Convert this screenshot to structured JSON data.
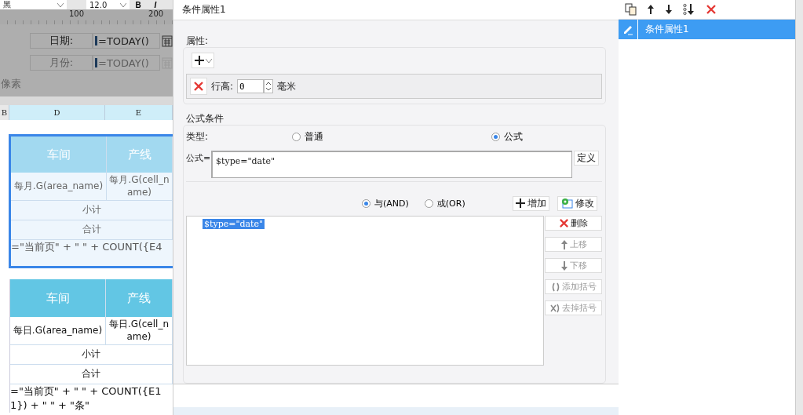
{
  "toolbar": {
    "font": "黑",
    "size": "12.0",
    "bold": "B",
    "italic": "I"
  },
  "ruler": {
    "ticks": [
      "100",
      "200"
    ]
  },
  "parameters": [
    {
      "label": "日期:",
      "value": "=TODAY()",
      "disabled": false
    },
    {
      "label": "月份:",
      "value": "=TODAY()",
      "disabled": true
    }
  ],
  "parameter_note": "像素",
  "column_headers": [
    "B",
    "D",
    "E"
  ],
  "report_tables": [
    {
      "selected": true,
      "headers": [
        "车间",
        "产线"
      ],
      "cells": [
        "每月.G(area_name)",
        "每月.G(cell_name)"
      ],
      "subtotal": "小计",
      "total": "合计",
      "footer": [
        "=\"当前页\" + \" \" + COUNT({E4"
      ]
    },
    {
      "selected": false,
      "headers": [
        "车间",
        "产线"
      ],
      "cells": [
        "每日.G(area_name)",
        "每日.G(cell_name)"
      ],
      "subtotal": "小计",
      "total": "合计",
      "footer": [
        "=\"当前页\" + \" \" + COUNT({E1",
        "1}) + \" \" + \"条\""
      ]
    }
  ],
  "dialog": {
    "title": "条件属性1",
    "properties": {
      "legend": "属性:",
      "rows": [
        {
          "label": "行高:",
          "value": "0",
          "unit": "毫米"
        }
      ]
    },
    "formula_condition": {
      "legend": "公式条件",
      "type_label": "类型:",
      "types": [
        {
          "label": "普通",
          "selected": false
        },
        {
          "label": "公式",
          "selected": true
        }
      ],
      "formula_label": "公式=",
      "formula": "$type=\"date\"",
      "define_button": "定义",
      "logic": [
        {
          "label": "与(AND)",
          "selected": true
        },
        {
          "label": "或(OR)",
          "selected": false
        }
      ],
      "add_button": "增加",
      "modify_button": "修改",
      "conditions": [
        {
          "text": "$type=\"date\"",
          "selected": true
        }
      ],
      "actions": [
        {
          "kind": "delete",
          "label": "删除",
          "disabled": false
        },
        {
          "kind": "up",
          "label": "上移",
          "disabled": true
        },
        {
          "kind": "down",
          "label": "下移",
          "disabled": true
        },
        {
          "kind": "add-brackets",
          "label": "添加括号",
          "disabled": true
        },
        {
          "kind": "remove-brackets",
          "label": "去掉括号",
          "disabled": true
        }
      ]
    }
  },
  "right_panel": {
    "items": [
      {
        "label": "条件属性1",
        "selected": true
      }
    ]
  }
}
